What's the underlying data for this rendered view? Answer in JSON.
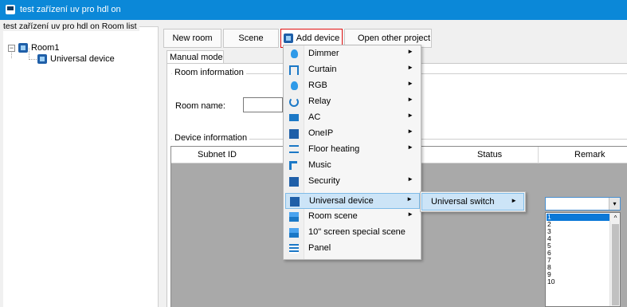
{
  "window": {
    "title": "test zařízení uv pro hdl on"
  },
  "tree": {
    "caption": "test zařízení uv pro hdl on  Room list",
    "expander": "−",
    "room": "Room1",
    "device": "Universal device"
  },
  "toolbar": {
    "new_room": "New room",
    "scene": "Scene",
    "add_device": "Add device",
    "open_other_project": "Open other project"
  },
  "main": {
    "tab": "Manual mode",
    "room_info": "Room information",
    "room_name_label": "Room name:",
    "device_info": "Device information",
    "columns": {
      "subnet_id": "Subnet ID",
      "status": "Status",
      "remark": "Remark"
    }
  },
  "add_device_menu": {
    "items": [
      {
        "label": "Dimmer",
        "icon": "bulb-icon",
        "submenu": true
      },
      {
        "label": "Curtain",
        "icon": "curtain-icon",
        "submenu": true
      },
      {
        "label": "RGB",
        "icon": "bulb-icon",
        "submenu": true
      },
      {
        "label": "Relay",
        "icon": "power-icon",
        "submenu": true
      },
      {
        "label": "AC",
        "icon": "ac-icon",
        "submenu": true
      },
      {
        "label": "OneIP",
        "icon": "device-icon",
        "submenu": true
      },
      {
        "label": "Floor heating",
        "icon": "heating-icon",
        "submenu": true
      },
      {
        "label": "Music",
        "icon": "music-icon",
        "submenu": false
      },
      {
        "label": "Security",
        "icon": "device-icon",
        "submenu": true
      },
      {
        "label": "Universal device",
        "icon": "device-icon",
        "submenu": true,
        "highlighted": true
      },
      {
        "label": "Room scene",
        "icon": "scene-icon",
        "submenu": true
      },
      {
        "label": "10\" screen special scene",
        "icon": "scene-icon",
        "submenu": false
      },
      {
        "label": "Panel",
        "icon": "panel-icon",
        "submenu": false
      }
    ],
    "arrow": "►"
  },
  "universal_submenu": {
    "item": "Universal switch",
    "arrow": "►"
  },
  "combo": {
    "value": "",
    "dropdown_glyph": "▾"
  },
  "listbox": {
    "items": [
      "1",
      "2",
      "3",
      "4",
      "5",
      "6",
      "7",
      "8",
      "9",
      "10"
    ],
    "selected": "1",
    "scroll_up_glyph": "^"
  }
}
